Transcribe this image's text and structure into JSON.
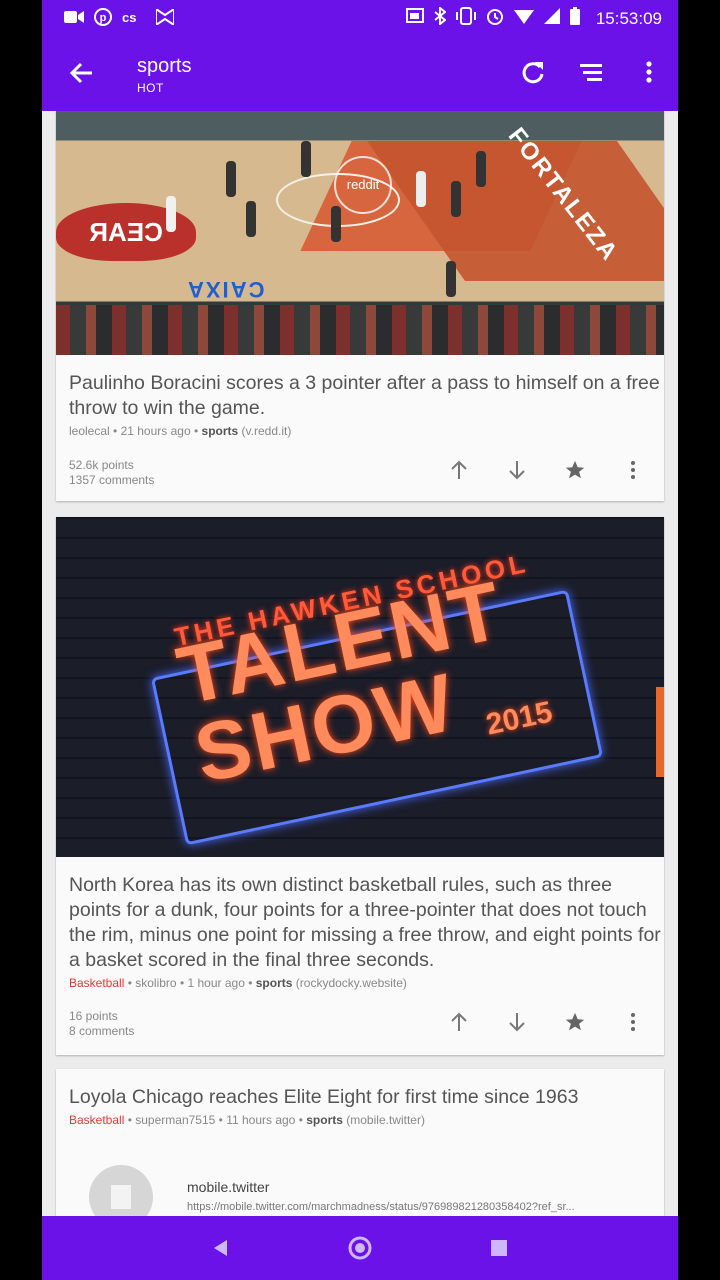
{
  "status_bar": {
    "time": "15:53:09",
    "left_icons": [
      "video-call-icon",
      "pinterest-icon",
      "cs-icon",
      "bowtie-icon"
    ],
    "right_icons": [
      "cast-icon",
      "bluetooth-icon",
      "vibrate-icon",
      "alarm-icon",
      "wifi-icon",
      "signal-icon",
      "battery-icon"
    ]
  },
  "app_bar": {
    "title": "sports",
    "subtitle": "HOT"
  },
  "posts": [
    {
      "title": "Paulinho Boracini scores a 3 pointer after a pass to himself on a free throw to win the game.",
      "flair": "",
      "author": "leolecal",
      "time": "21 hours ago",
      "subreddit": "sports",
      "domain": "(v.redd.it)",
      "points": "52.6k points",
      "comments": "1357 comments",
      "thumbnail_watermark": "reddit"
    },
    {
      "title": "North Korea has its own distinct basketball rules, such as three points for a dunk, four points for a three-pointer that does not touch the rim, minus one point for missing a free throw, and eight points for a basket scored in the final three seconds.",
      "flair": "Basketball",
      "author": "skolibro",
      "time": "1 hour ago",
      "subreddit": "sports",
      "domain": "(rockydocky.website)",
      "points": "16 points",
      "comments": "8 comments",
      "thumbnail_text": {
        "line1": "THE HAWKEN SCHOOL",
        "line2": "TALENT",
        "line3": "SHOW",
        "year": "2015"
      }
    },
    {
      "title": "Loyola Chicago reaches Elite Eight for first time since 1963",
      "flair": "Basketball",
      "author": "superman7515",
      "time": "11 hours ago",
      "subreddit": "sports",
      "domain": "(mobile.twitter)",
      "link_domain": "mobile.twitter",
      "link_url": "https://mobile.twitter.com/marchmadness/status/976989821280358402?ref_sr..."
    }
  ],
  "sep": " • ",
  "colors": {
    "accent": "#6a12e8",
    "flair": "#e53935"
  }
}
